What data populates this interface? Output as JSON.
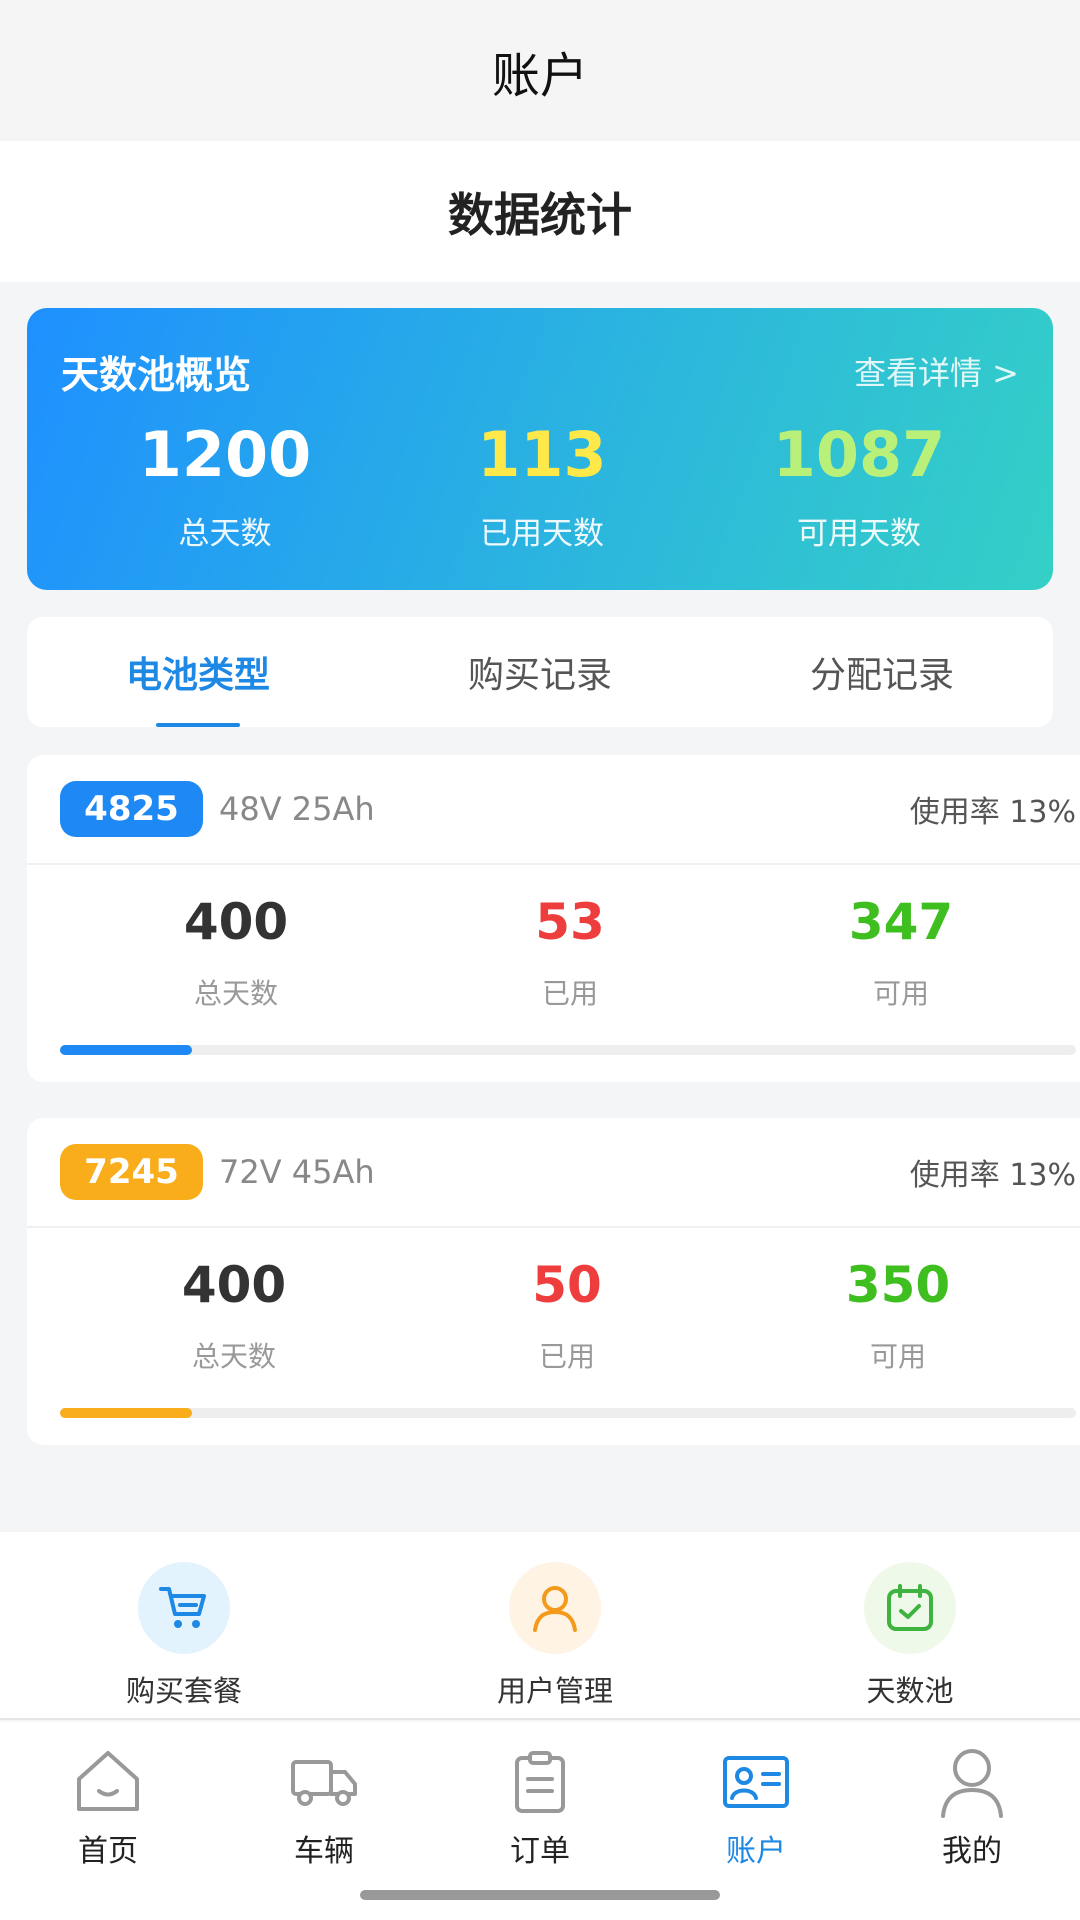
{
  "navbar": {
    "title": "账户"
  },
  "page": {
    "title": "数据统计"
  },
  "overview": {
    "title": "天数池概览",
    "link": "查看详情 >",
    "stats": [
      {
        "value": "1200",
        "label": "总天数",
        "color": "#ffffff"
      },
      {
        "value": "113",
        "label": "已用天数",
        "color": "#ffe84a"
      },
      {
        "value": "1087",
        "label": "可用天数",
        "color": "#b9f07a"
      }
    ]
  },
  "tabs": [
    {
      "label": "电池类型",
      "active": true
    },
    {
      "label": "购买记录",
      "active": false
    },
    {
      "label": "分配记录",
      "active": false
    }
  ],
  "batteries": [
    {
      "code": "4825",
      "spec": "48V 25Ah",
      "rate": "使用率 13%",
      "color": "#1e88f5",
      "usage_fraction": 0.13,
      "stats": [
        {
          "value": "400",
          "label": "总天数"
        },
        {
          "value": "53",
          "label": "已用"
        },
        {
          "value": "347",
          "label": "可用"
        }
      ]
    },
    {
      "code": "7245",
      "spec": "72V 45Ah",
      "rate": "使用率 13%",
      "color": "#f9ad1a",
      "usage_fraction": 0.13,
      "stats": [
        {
          "value": "400",
          "label": "总天数"
        },
        {
          "value": "50",
          "label": "已用"
        },
        {
          "value": "350",
          "label": "可用"
        }
      ]
    }
  ],
  "colors": {
    "total": "#333333",
    "used": "#ee3d3d",
    "available": "#3fbf1f",
    "accent": "#1e88e5"
  },
  "quick_actions": [
    {
      "label": "购买套餐",
      "icon": "cart-icon"
    },
    {
      "label": "用户管理",
      "icon": "user-icon"
    },
    {
      "label": "天数池",
      "icon": "calendar-check-icon"
    }
  ],
  "tabbar": [
    {
      "label": "首页",
      "icon": "home-icon",
      "active": false
    },
    {
      "label": "车辆",
      "icon": "truck-icon",
      "active": false
    },
    {
      "label": "订单",
      "icon": "clipboard-icon",
      "active": false
    },
    {
      "label": "账户",
      "icon": "account-card-icon",
      "active": true
    },
    {
      "label": "我的",
      "icon": "profile-icon",
      "active": false
    }
  ]
}
